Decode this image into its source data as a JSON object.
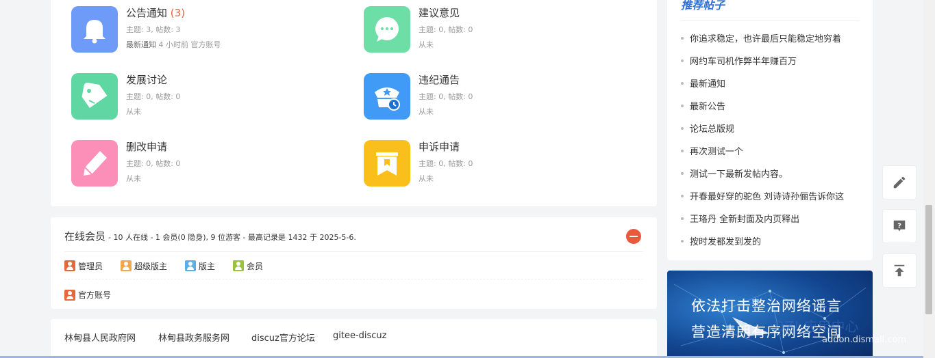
{
  "forums": [
    {
      "name": "公告通知",
      "count": "(3)",
      "stats": "主题: 3,  帖数: 3",
      "last_label": "最新通知",
      "last_time": "4 小时前",
      "last_user": "官方账号",
      "color": "#6f9bf8",
      "icon": "bell-icon"
    },
    {
      "name": "建议意见",
      "count": "",
      "stats": "主题: 0,  帖数: 0",
      "last_label": "从未",
      "last_time": "",
      "last_user": "",
      "color": "#6ddfa6",
      "icon": "chat-bubble-icon"
    },
    {
      "name": "发展讨论",
      "count": "",
      "stats": "主题: 0,  帖数: 0",
      "last_label": "从未",
      "last_time": "",
      "last_user": "",
      "color": "#5ed7a2",
      "icon": "tag-icon"
    },
    {
      "name": "违纪通告",
      "count": "",
      "stats": "主题: 0,  帖数: 0",
      "last_label": "从未",
      "last_time": "",
      "last_user": "",
      "color": "#3f9bf6",
      "icon": "police-cap-icon"
    },
    {
      "name": "删改申请",
      "count": "",
      "stats": "主题: 0,  帖数: 0",
      "last_label": "从未",
      "last_time": "",
      "last_user": "",
      "color": "#fb8fb8",
      "icon": "pencil-icon"
    },
    {
      "name": "申诉申请",
      "count": "",
      "stats": "主题: 0,  帖数: 0",
      "last_label": "从未",
      "last_time": "",
      "last_user": "",
      "color": "#fbbf1c",
      "icon": "bookmark-icon"
    }
  ],
  "online": {
    "title": "在线会员",
    "summary": "- 10 人在线 - 1 会员(0 隐身), 9 位游客 - 最高记录是 1432 于 2025-5-6.",
    "legend": [
      {
        "label": "管理员",
        "color": "#e8673a"
      },
      {
        "label": "超级版主",
        "color": "#f0a64a"
      },
      {
        "label": "版主",
        "color": "#5ab0e6"
      },
      {
        "label": "会员",
        "color": "#9ac23c"
      }
    ],
    "members": [
      {
        "name": "官方账号",
        "color": "#e8673a"
      }
    ]
  },
  "links": [
    "林甸县人民政府网",
    "林甸县政务服务网",
    "discuz官方论坛",
    "gitee-discuz"
  ],
  "sidebar": {
    "title": "推荐帖子",
    "items": [
      "你追求稳定，也许最后只能稳定地穷着",
      "网约车司机作弊半年赚百万",
      "最新通知",
      "最新公告",
      "论坛总版规",
      "再次测试一个",
      "测试一下最新发帖内容。",
      "开春最好穿的驼色 刘诗诗孙俪告诉你这",
      "王珞丹 全新封面及内页释出",
      "按时发都发到发的"
    ]
  },
  "banner": {
    "line1": "依法打击整治网络谣言",
    "line2": "营造清朗有序网络空间"
  },
  "watermark": {
    "brand": "DZ! 应用中心",
    "domain": "addon.dismall.com"
  },
  "float_buttons": [
    "edit-icon",
    "help-icon",
    "back-to-top-icon"
  ]
}
